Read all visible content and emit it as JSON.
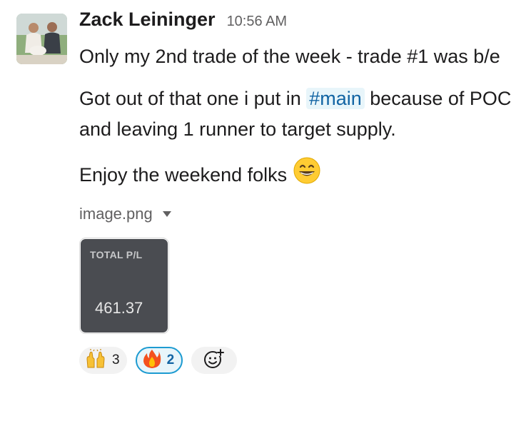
{
  "message": {
    "sender": "Zack Leininger",
    "timestamp": "10:56 AM",
    "paragraph1": "Only my 2nd trade of the week - trade #1 was b/e",
    "paragraph2_before": "Got out of that one i put in ",
    "paragraph2_channel": "#main",
    "paragraph2_after": " because of POC and leaving 1 runner to target supply.",
    "paragraph3": "Enjoy the weekend folks",
    "paragraph3_emoji": "grinning-face-with-smiling-eyes"
  },
  "attachment": {
    "file_name": "image.png",
    "thumbnail_label": "TOTAL P/L",
    "thumbnail_value": "461.37"
  },
  "reactions": [
    {
      "emoji": "raised-hands",
      "count": "3",
      "active": false
    },
    {
      "emoji": "fire",
      "count": "2",
      "active": true
    }
  ],
  "add_reaction_icon": "add-reaction-icon",
  "colors": {
    "link": "#1264a3",
    "active_reaction_border": "#1d9bd1",
    "thumbnail_bg": "#4a4c51"
  }
}
